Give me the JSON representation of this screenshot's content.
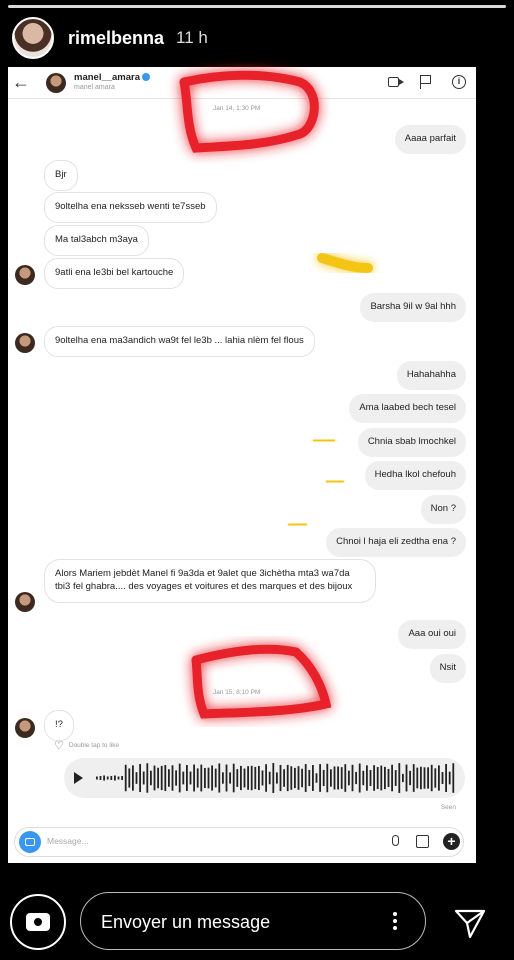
{
  "story": {
    "username": "rimelbenna",
    "time": "11 h",
    "reply_placeholder": "Envoyer un message"
  },
  "dm": {
    "name": "manel__amara",
    "subtitle": "manel amara",
    "timestamps": [
      "Jan 14, 1:30 PM",
      "Jan 15, 8:10 PM"
    ],
    "messages": [
      {
        "side": "out",
        "text": "Aaaa parfait"
      },
      {
        "side": "in",
        "text": "Bjr"
      },
      {
        "side": "in",
        "text": "9oltelha ena neksseb wenti te7sseb"
      },
      {
        "side": "in",
        "text": "Ma tal3abch m3aya"
      },
      {
        "side": "in",
        "text": "9atli ena le3bi bel kartouche"
      },
      {
        "side": "out",
        "text": "Barsha 9il w 9al hhh"
      },
      {
        "side": "in",
        "text": "9oltelha ena ma3andich wa9t fel le3b ... lahia nlèm fel flous"
      },
      {
        "side": "out",
        "text": "Hahahahha"
      },
      {
        "side": "out",
        "text": "Ama laabed bech tesel"
      },
      {
        "side": "out",
        "text": "Chnia sbab lmochkel"
      },
      {
        "side": "out",
        "text": "Hedha lkol chefouh"
      },
      {
        "side": "out",
        "text": "Non ?"
      },
      {
        "side": "out",
        "text": "Chnoi l haja eli zedtha ena ?"
      },
      {
        "side": "in",
        "text": "Alors Mariem jebdèt Manel fi 9a3da et 9alet que 3ichètha mta3 wa7da tbi3 fel ghabra.... des voyages et voitures et des marques et des bijoux"
      },
      {
        "side": "out",
        "text": "Aaa oui oui"
      },
      {
        "side": "out",
        "text": "Nsit"
      },
      {
        "side": "in",
        "text": "!?"
      }
    ],
    "like_hint": "Double tap to like",
    "seen": "Seen",
    "composer_placeholder": "Message..."
  },
  "icons": {
    "back": "back-arrow-icon",
    "video": "video-call-icon",
    "flag": "flag-icon",
    "info": "info-icon",
    "play": "play-icon",
    "camera": "camera-icon",
    "send": "send-icon"
  },
  "colors": {
    "doodle_red": "#e8202a",
    "doodle_yellow": "#f5c518",
    "instagram_blue": "#3897f0"
  }
}
